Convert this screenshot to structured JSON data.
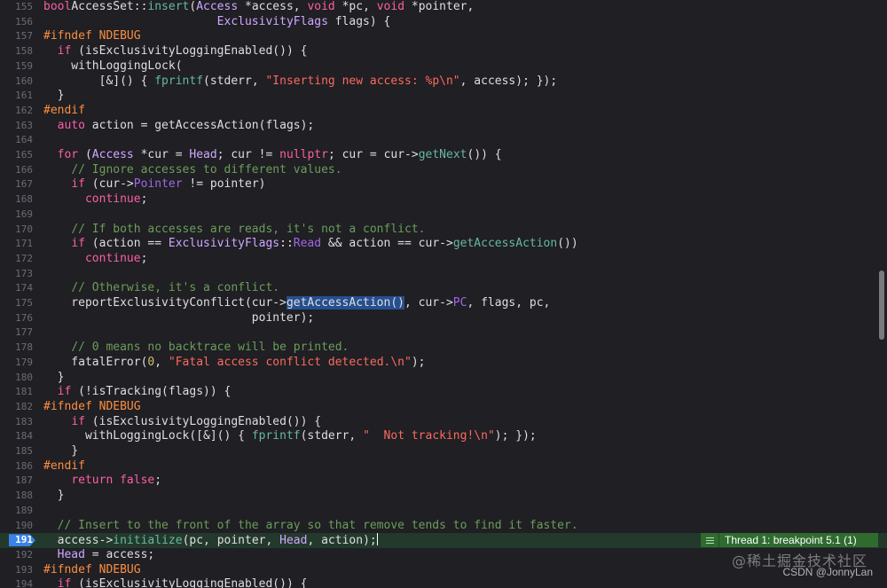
{
  "editor": {
    "lines": [
      {
        "n": "155",
        "tokens": [
          [
            "kw",
            "bool"
          ],
          [
            "",
            "AccessSet::"
          ],
          [
            "fn",
            "insert"
          ],
          [
            "",
            "("
          ],
          [
            "ty",
            "Access"
          ],
          [
            "",
            " *access, "
          ],
          [
            "kw",
            "void"
          ],
          [
            "",
            " *pc, "
          ],
          [
            "kw",
            "void"
          ],
          [
            "",
            " *pointer,"
          ]
        ]
      },
      {
        "n": "156",
        "tokens": [
          [
            "",
            "                         "
          ],
          [
            "ty",
            "ExclusivityFlags"
          ],
          [
            "",
            " flags) {"
          ]
        ]
      },
      {
        "n": "157",
        "tokens": [
          [
            "pp",
            "#ifndef NDEBUG"
          ]
        ]
      },
      {
        "n": "158",
        "tokens": [
          [
            "",
            "  "
          ],
          [
            "kw",
            "if"
          ],
          [
            "",
            " (isExclusivityLoggingEnabled()) {"
          ]
        ]
      },
      {
        "n": "159",
        "tokens": [
          [
            "",
            "    withLoggingLock("
          ]
        ]
      },
      {
        "n": "160",
        "tokens": [
          [
            "",
            "        [&]() { "
          ],
          [
            "fn",
            "fprintf"
          ],
          [
            "",
            "(stderr, "
          ],
          [
            "str",
            "\"Inserting new access: %p\\n\""
          ],
          [
            "",
            ", access); });"
          ]
        ]
      },
      {
        "n": "161",
        "tokens": [
          [
            "",
            "  }"
          ]
        ]
      },
      {
        "n": "162",
        "tokens": [
          [
            "pp",
            "#endif"
          ]
        ]
      },
      {
        "n": "163",
        "tokens": [
          [
            "",
            "  "
          ],
          [
            "kw",
            "auto"
          ],
          [
            "",
            " action = getAccessAction(flags);"
          ]
        ]
      },
      {
        "n": "164",
        "tokens": [
          [
            "",
            ""
          ]
        ]
      },
      {
        "n": "165",
        "tokens": [
          [
            "",
            "  "
          ],
          [
            "kw",
            "for"
          ],
          [
            "",
            " ("
          ],
          [
            "ty",
            "Access"
          ],
          [
            "",
            " *cur = "
          ],
          [
            "ty",
            "Head"
          ],
          [
            "",
            "; cur != "
          ],
          [
            "kw",
            "nullptr"
          ],
          [
            "",
            "; cur = cur->"
          ],
          [
            "fn",
            "getNext"
          ],
          [
            "",
            "()) {"
          ]
        ]
      },
      {
        "n": "166",
        "tokens": [
          [
            "",
            "    "
          ],
          [
            "cmt",
            "// Ignore accesses to different values."
          ]
        ]
      },
      {
        "n": "167",
        "tokens": [
          [
            "",
            "    "
          ],
          [
            "kw",
            "if"
          ],
          [
            "",
            " (cur->"
          ],
          [
            "mem",
            "Pointer"
          ],
          [
            "",
            " != pointer)"
          ]
        ]
      },
      {
        "n": "168",
        "tokens": [
          [
            "",
            "      "
          ],
          [
            "kw",
            "continue"
          ],
          [
            "",
            ";"
          ]
        ]
      },
      {
        "n": "169",
        "tokens": [
          [
            "",
            ""
          ]
        ]
      },
      {
        "n": "170",
        "tokens": [
          [
            "",
            "    "
          ],
          [
            "cmt",
            "// If both accesses are reads, it's not a conflict."
          ]
        ]
      },
      {
        "n": "171",
        "tokens": [
          [
            "",
            "    "
          ],
          [
            "kw",
            "if"
          ],
          [
            "",
            " (action == "
          ],
          [
            "ty",
            "ExclusivityFlags"
          ],
          [
            "",
            "::"
          ],
          [
            "mem",
            "Read"
          ],
          [
            "",
            " && action == cur->"
          ],
          [
            "fn",
            "getAccessAction"
          ],
          [
            "",
            "())"
          ]
        ]
      },
      {
        "n": "172",
        "tokens": [
          [
            "",
            "      "
          ],
          [
            "kw",
            "continue"
          ],
          [
            "",
            ";"
          ]
        ]
      },
      {
        "n": "173",
        "tokens": [
          [
            "",
            ""
          ]
        ]
      },
      {
        "n": "174",
        "tokens": [
          [
            "",
            "    "
          ],
          [
            "cmt",
            "// Otherwise, it's a conflict."
          ]
        ]
      },
      {
        "n": "175",
        "tokens": [
          [
            "",
            "    reportExclusivityConflict(cur->"
          ],
          [
            "sel",
            "getAccessAction()"
          ],
          [
            "",
            ", cur->"
          ],
          [
            "mem",
            "PC"
          ],
          [
            "",
            ", flags, pc,"
          ]
        ]
      },
      {
        "n": "176",
        "tokens": [
          [
            "",
            "                              pointer);"
          ]
        ]
      },
      {
        "n": "177",
        "tokens": [
          [
            "",
            ""
          ]
        ]
      },
      {
        "n": "178",
        "tokens": [
          [
            "",
            "    "
          ],
          [
            "cmt",
            "// 0 means no backtrace will be printed."
          ]
        ]
      },
      {
        "n": "179",
        "tokens": [
          [
            "",
            "    fatalError("
          ],
          [
            "num",
            "0"
          ],
          [
            "",
            ", "
          ],
          [
            "str",
            "\"Fatal access conflict detected.\\n\""
          ],
          [
            "",
            ");"
          ]
        ]
      },
      {
        "n": "180",
        "tokens": [
          [
            "",
            "  }"
          ]
        ]
      },
      {
        "n": "181",
        "tokens": [
          [
            "",
            "  "
          ],
          [
            "kw",
            "if"
          ],
          [
            "",
            " (!isTracking(flags)) {"
          ]
        ]
      },
      {
        "n": "182",
        "tokens": [
          [
            "pp",
            "#ifndef NDEBUG"
          ]
        ]
      },
      {
        "n": "183",
        "tokens": [
          [
            "",
            "    "
          ],
          [
            "kw",
            "if"
          ],
          [
            "",
            " (isExclusivityLoggingEnabled()) {"
          ]
        ]
      },
      {
        "n": "184",
        "tokens": [
          [
            "",
            "      withLoggingLock([&]() { "
          ],
          [
            "fn",
            "fprintf"
          ],
          [
            "",
            "(stderr, "
          ],
          [
            "str",
            "\"  Not tracking!\\n\""
          ],
          [
            "",
            "); });"
          ]
        ]
      },
      {
        "n": "185",
        "tokens": [
          [
            "",
            "    }"
          ]
        ]
      },
      {
        "n": "186",
        "tokens": [
          [
            "pp",
            "#endif"
          ]
        ]
      },
      {
        "n": "187",
        "tokens": [
          [
            "",
            "    "
          ],
          [
            "kw",
            "return"
          ],
          [
            "",
            " "
          ],
          [
            "kw",
            "false"
          ],
          [
            "",
            ";"
          ]
        ]
      },
      {
        "n": "188",
        "tokens": [
          [
            "",
            "  }"
          ]
        ]
      },
      {
        "n": "189",
        "tokens": [
          [
            "",
            ""
          ]
        ]
      },
      {
        "n": "190",
        "tokens": [
          [
            "",
            "  "
          ],
          [
            "cmt",
            "// Insert to the front of the array so that remove tends to find it faster."
          ]
        ]
      },
      {
        "n": "191",
        "current": true,
        "tokens": [
          [
            "",
            "  access->"
          ],
          [
            "fn",
            "initialize"
          ],
          [
            "",
            "(pc, pointer, "
          ],
          [
            "ty",
            "Head"
          ],
          [
            "",
            ", action);"
          ]
        ]
      },
      {
        "n": "192",
        "tokens": [
          [
            "",
            "  "
          ],
          [
            "ty",
            "Head"
          ],
          [
            "",
            " = access;"
          ]
        ]
      },
      {
        "n": "193",
        "tokens": [
          [
            "pp",
            "#ifndef NDEBUG"
          ]
        ]
      },
      {
        "n": "194",
        "tokens": [
          [
            "",
            "  "
          ],
          [
            "kw",
            "if"
          ],
          [
            "",
            " (isExclusivityLoggingEnabled()) {"
          ]
        ]
      }
    ]
  },
  "breakpoint_banner": {
    "label": "Thread 1: breakpoint 5.1 (1)",
    "icon": "hamburger-icon",
    "color": "#2f6b2f"
  },
  "watermark": {
    "text": "@稀土掘金技术社区"
  },
  "attribution": {
    "text": "CSDN @JonnyLan"
  },
  "colors": {
    "background": "#1f1f24",
    "current_line": "#23392c",
    "breakpoint_marker": "#3b82e6",
    "keyword": "#fc5fa3",
    "string": "#fc6a5d",
    "comment": "#6c9d58",
    "preprocessor": "#fd8f3f"
  }
}
